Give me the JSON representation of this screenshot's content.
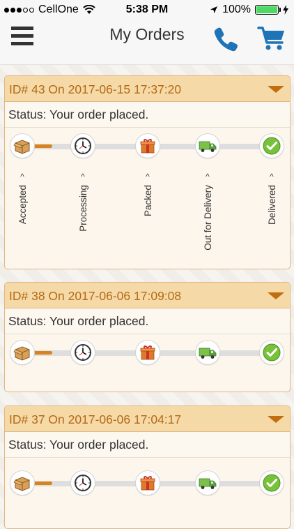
{
  "status_bar": {
    "carrier": "CellOne",
    "time": "5:38 PM",
    "battery": "100%",
    "signal_bars_filled": 3,
    "signal_bars_total": 5
  },
  "header": {
    "title": "My Orders",
    "left_icon": "menu-icon",
    "right_icons": [
      "phone-icon",
      "cart-icon"
    ]
  },
  "steps": [
    "Accepted",
    "Processing",
    "Packed",
    "Out for Delivery",
    "Delivered"
  ],
  "step_icons": [
    "box-icon",
    "clock-icon",
    "gift-icon",
    "truck-icon",
    "check-icon"
  ],
  "orders": [
    {
      "title": "ID# 43 On 2017-06-15 17:37:20",
      "status": "Status: Your order placed."
    },
    {
      "title": "ID# 38 On 2017-06-06 17:09:08",
      "status": "Status: Your order placed."
    },
    {
      "title": "ID# 37 On 2017-06-06 17:04:17",
      "status": "Status: Your order placed."
    }
  ],
  "colors": {
    "accent": "#c06e10",
    "header_bg": "#f5d9a7",
    "progress": "#d9831e",
    "icon_blue": "#1f73b7"
  }
}
